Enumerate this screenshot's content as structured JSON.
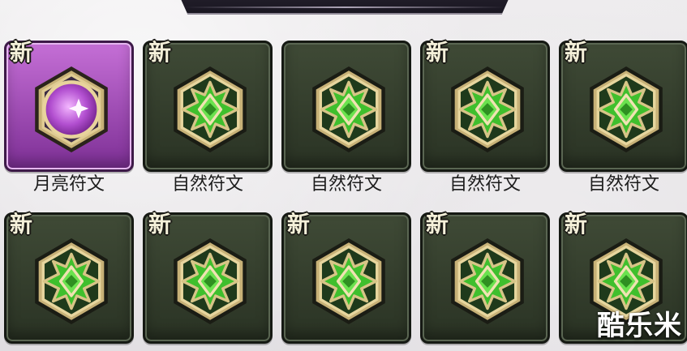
{
  "header": {
    "title": ""
  },
  "watermark": {
    "text": "酷乐米"
  },
  "grid": {
    "items": [
      {
        "badge": "新",
        "label": "月亮符文",
        "icon": "moon-rune-icon",
        "color": "#b24fd0"
      },
      {
        "badge": "新",
        "label": "自然符文",
        "icon": "nature-rune-icon",
        "color": "#3fbf2d"
      },
      {
        "badge": "",
        "label": "自然符文",
        "icon": "nature-rune-icon",
        "color": "#3fbf2d"
      },
      {
        "badge": "新",
        "label": "自然符文",
        "icon": "nature-rune-icon",
        "color": "#3fbf2d"
      },
      {
        "badge": "新",
        "label": "自然符文",
        "icon": "nature-rune-icon",
        "color": "#3fbf2d"
      },
      {
        "badge": "新",
        "label": "",
        "icon": "nature-rune-icon",
        "color": "#3fbf2d"
      },
      {
        "badge": "新",
        "label": "",
        "icon": "nature-rune-icon",
        "color": "#3fbf2d"
      },
      {
        "badge": "新",
        "label": "",
        "icon": "nature-rune-icon",
        "color": "#3fbf2d"
      },
      {
        "badge": "新",
        "label": "",
        "icon": "nature-rune-icon",
        "color": "#3fbf2d"
      },
      {
        "badge": "新",
        "label": "",
        "icon": "nature-rune-icon",
        "color": "#3fbf2d"
      }
    ]
  }
}
